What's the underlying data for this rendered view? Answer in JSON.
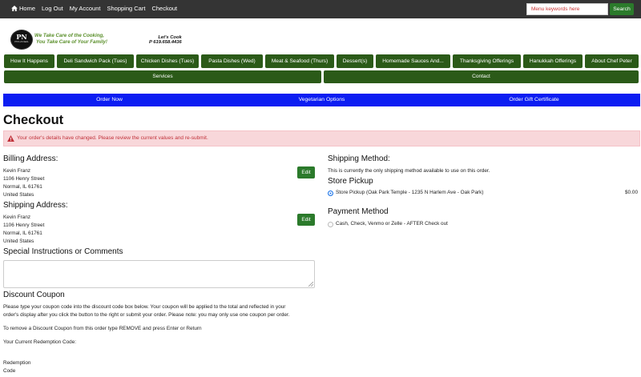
{
  "topnav": {
    "items": [
      "Home",
      "Log Out",
      "My Account",
      "Shopping Cart",
      "Checkout"
    ],
    "search_placeholder": "Menu keywords here",
    "search_button": "Search"
  },
  "brand": {
    "logo_text": "PN",
    "logo_subtext": "PHYLLIS NEAL",
    "tagline_line1": "We Take Care of the Cooking,",
    "tagline_line2": "You Take Care of Your Family!",
    "cook_line1": "Let's Cook",
    "cook_line2": "P 619.658.4436"
  },
  "main_nav": {
    "items": [
      "How It Happens",
      "Deli Sandwich Pack (Tues)",
      "Chicken Dishes (Tues)",
      "Pasta Dishes (Wed)",
      "Meat & Seafood (Thurs)",
      "Dessert(s)",
      "Homemade Sauces And...",
      "Thanksgiving Offerings",
      "Hanukkah Offerings",
      "About Chef Peter"
    ],
    "services": "Services",
    "contact": "Contact"
  },
  "blue_nav": {
    "items": [
      "Order Now",
      "Vegetarian Options",
      "Order Gift Certificate"
    ]
  },
  "page": {
    "title": "Checkout",
    "alert": "Your order's details have changed. Please review the current values and re-submit."
  },
  "billing": {
    "heading": "Billing Address:",
    "name": "Kevin Franz",
    "street": "1106 Henry Street",
    "city": "Normal, IL 61761",
    "country": "United States",
    "edit": "Edit"
  },
  "shipping_address": {
    "heading": "Shipping Address:",
    "name": "Kevin Franz",
    "street": "1106 Henry Street",
    "city": "Normal, IL 61761",
    "country": "United States",
    "edit": "Edit"
  },
  "special": {
    "heading": "Special Instructions or Comments"
  },
  "coupon": {
    "heading": "Discount Coupon",
    "text1": "Please type your coupon code into the discount code box below. Your coupon will be applied to the total and reflected in your",
    "text2": "order's display after you click the button to the right or submit your order. Please note: you may only use one coupon per order.",
    "remove_text": "To remove a Discount Coupon from this order type REMOVE and press Enter or Return",
    "current_code": "Your Current Redemption Code:",
    "redemption_line1": "Redemption",
    "redemption_line2": "Code"
  },
  "shipping_method": {
    "heading": "Shipping Method:",
    "note": "This is currently the only shipping method available to use on this order.",
    "subheading": "Store Pickup",
    "option_label": "Store Pickup (Oak Park Temple - 1235 N Harlem Ave - Oak Park)",
    "option_price": "$0.00"
  },
  "payment": {
    "heading": "Payment Method",
    "option_label": "Cash, Check, Venmo or Zelle - AFTER Check out"
  },
  "colors": {
    "nav_green": "#2b5a18",
    "button_green": "#2b7a2b",
    "blue_bar": "#0c1df2",
    "alert_bg": "#f8d7da",
    "alert_text": "#c0323a"
  }
}
